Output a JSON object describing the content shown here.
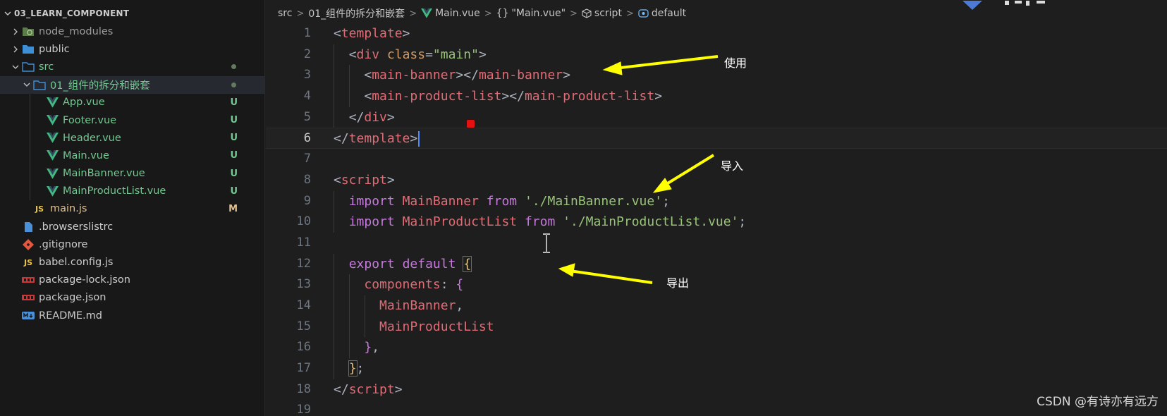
{
  "explorer": {
    "root_label": "03_LEARN_COMPONENT",
    "items": [
      {
        "label": "node_modules",
        "icon": "node-modules-folder-icon",
        "expanded": false
      },
      {
        "label": "public",
        "icon": "folder-icon",
        "expanded": false
      },
      {
        "label": "src",
        "icon": "folder-icon",
        "expanded": true
      },
      {
        "label": "01_组件的拆分和嵌套",
        "icon": "folder-icon",
        "expanded": true
      },
      {
        "label": "App.vue",
        "icon": "vue-icon",
        "badge": "U"
      },
      {
        "label": "Footer.vue",
        "icon": "vue-icon",
        "badge": "U"
      },
      {
        "label": "Header.vue",
        "icon": "vue-icon",
        "badge": "U"
      },
      {
        "label": "Main.vue",
        "icon": "vue-icon",
        "badge": "U"
      },
      {
        "label": "MainBanner.vue",
        "icon": "vue-icon",
        "badge": "U"
      },
      {
        "label": "MainProductList.vue",
        "icon": "vue-icon",
        "badge": "U"
      },
      {
        "label": "main.js",
        "icon": "js-icon",
        "badge": "M"
      },
      {
        "label": ".browserslistrc",
        "icon": "file-icon"
      },
      {
        "label": ".gitignore",
        "icon": "git-icon"
      },
      {
        "label": "babel.config.js",
        "icon": "js-icon"
      },
      {
        "label": "package-lock.json",
        "icon": "npm-icon"
      },
      {
        "label": "package.json",
        "icon": "npm-icon"
      },
      {
        "label": "README.md",
        "icon": "markdown-icon"
      }
    ]
  },
  "breadcrumb": {
    "src": "src",
    "folder": "01_组件的拆分和嵌套",
    "file": "Main.vue",
    "component": "\"Main.vue\"",
    "component_prefix": "{}",
    "section": "script",
    "symbol": "default"
  },
  "editor": {
    "current_line": 6,
    "lines": [
      "1",
      "2",
      "3",
      "4",
      "5",
      "6",
      "7",
      "8",
      "9",
      "10",
      "11",
      "12",
      "13",
      "14",
      "15",
      "16",
      "17",
      "18",
      "19"
    ]
  },
  "annotations": {
    "use": "使用",
    "import": "导入",
    "export": "导出"
  },
  "watermark": "CSDN @有诗亦有远方",
  "colors": {
    "vue_green": "#42b883",
    "js_yellow": "#e8c33d",
    "annotation_arrow": "#ffff00",
    "untracked": "#73c991",
    "modified": "#e2c08d"
  }
}
